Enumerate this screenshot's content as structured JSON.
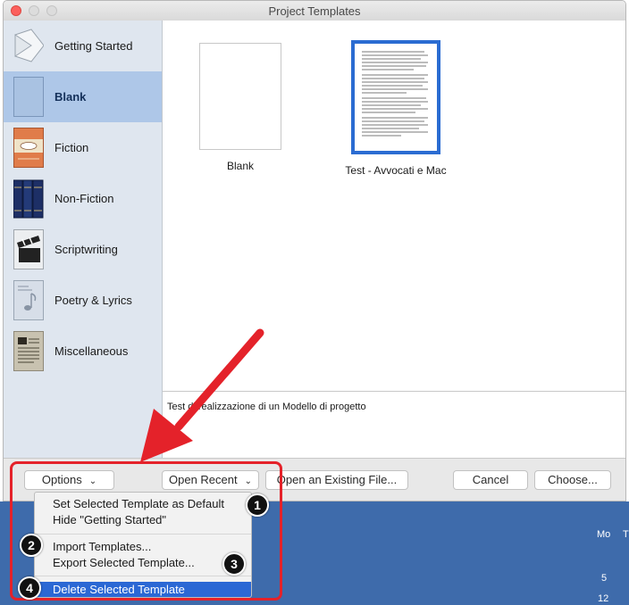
{
  "window": {
    "title": "Project Templates"
  },
  "sidebar": {
    "items": [
      {
        "label": "Getting Started",
        "icon": "getting-started-icon"
      },
      {
        "label": "Blank",
        "icon": "blank-icon",
        "selected": true
      },
      {
        "label": "Fiction",
        "icon": "fiction-icon"
      },
      {
        "label": "Non-Fiction",
        "icon": "non-fiction-icon"
      },
      {
        "label": "Scriptwriting",
        "icon": "scriptwriting-icon"
      },
      {
        "label": "Poetry & Lyrics",
        "icon": "poetry-lyrics-icon"
      },
      {
        "label": "Miscellaneous",
        "icon": "miscellaneous-icon"
      }
    ]
  },
  "templates": [
    {
      "label": "Blank"
    },
    {
      "label": "Test - Avvocati e Mac",
      "selected": true
    }
  ],
  "description": "Test di realizzazione di un Modello di progetto",
  "buttons": {
    "options": "Options",
    "open_recent": "Open Recent",
    "open_existing": "Open an Existing File...",
    "cancel": "Cancel",
    "choose": "Choose..."
  },
  "options_menu": {
    "items": [
      "Set Selected Template as Default",
      "Hide \"Getting Started\"",
      "Import Templates...",
      "Export Selected Template...",
      "Delete Selected Template"
    ],
    "highlighted_index": 4
  },
  "badges": [
    "1",
    "2",
    "3",
    "4"
  ],
  "background_calendar": {
    "weekday": "Mo",
    "day_1": "5",
    "day_2": "12"
  },
  "colors": {
    "selection": "#aec7e8",
    "menu_highlight": "#2b68d4",
    "annotation": "#e4222a"
  }
}
